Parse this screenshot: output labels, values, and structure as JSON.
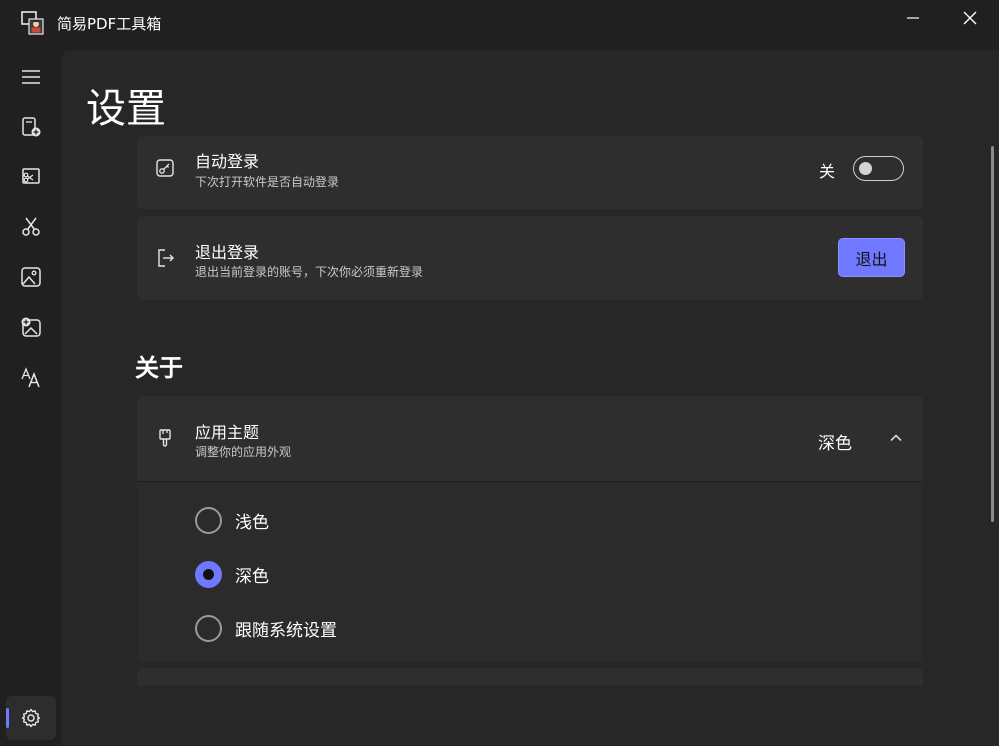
{
  "app": {
    "title": "简易PDF工具箱",
    "icon": "app-logo-icon"
  },
  "window_controls": {
    "minimize_icon": "minimize-icon",
    "close_icon": "close-icon"
  },
  "nav": {
    "items": [
      {
        "icon": "menu-icon"
      },
      {
        "icon": "pdf-create-icon"
      },
      {
        "icon": "crop-icon"
      },
      {
        "icon": "scissors-icon"
      },
      {
        "icon": "image-icon"
      },
      {
        "icon": "image-add-icon"
      },
      {
        "icon": "font-size-icon"
      }
    ],
    "settings": {
      "icon": "gear-icon",
      "selected": true
    }
  },
  "page": {
    "title": "设置"
  },
  "account": {
    "auto_login": {
      "title": "自动登录",
      "desc": "下次打开软件是否自动登录",
      "toggle_label": "关",
      "toggle_on": false,
      "icon": "auto-login-icon"
    },
    "logout": {
      "title": "退出登录",
      "desc": "退出当前登录的账号，下次你必须重新登录",
      "button": "退出",
      "icon": "logout-icon"
    }
  },
  "about": {
    "section_title": "关于",
    "theme": {
      "title": "应用主题",
      "desc": "调整你的应用外观",
      "value": "深色",
      "icon": "brush-icon",
      "expanded": true,
      "options": [
        {
          "label": "浅色",
          "checked": false
        },
        {
          "label": "深色",
          "checked": true
        },
        {
          "label": "跟随系统设置",
          "checked": false
        }
      ]
    }
  },
  "colors": {
    "accent": "#6f78ff",
    "background": "#202020",
    "panel": "#272727",
    "card": "#2e2e2e"
  }
}
